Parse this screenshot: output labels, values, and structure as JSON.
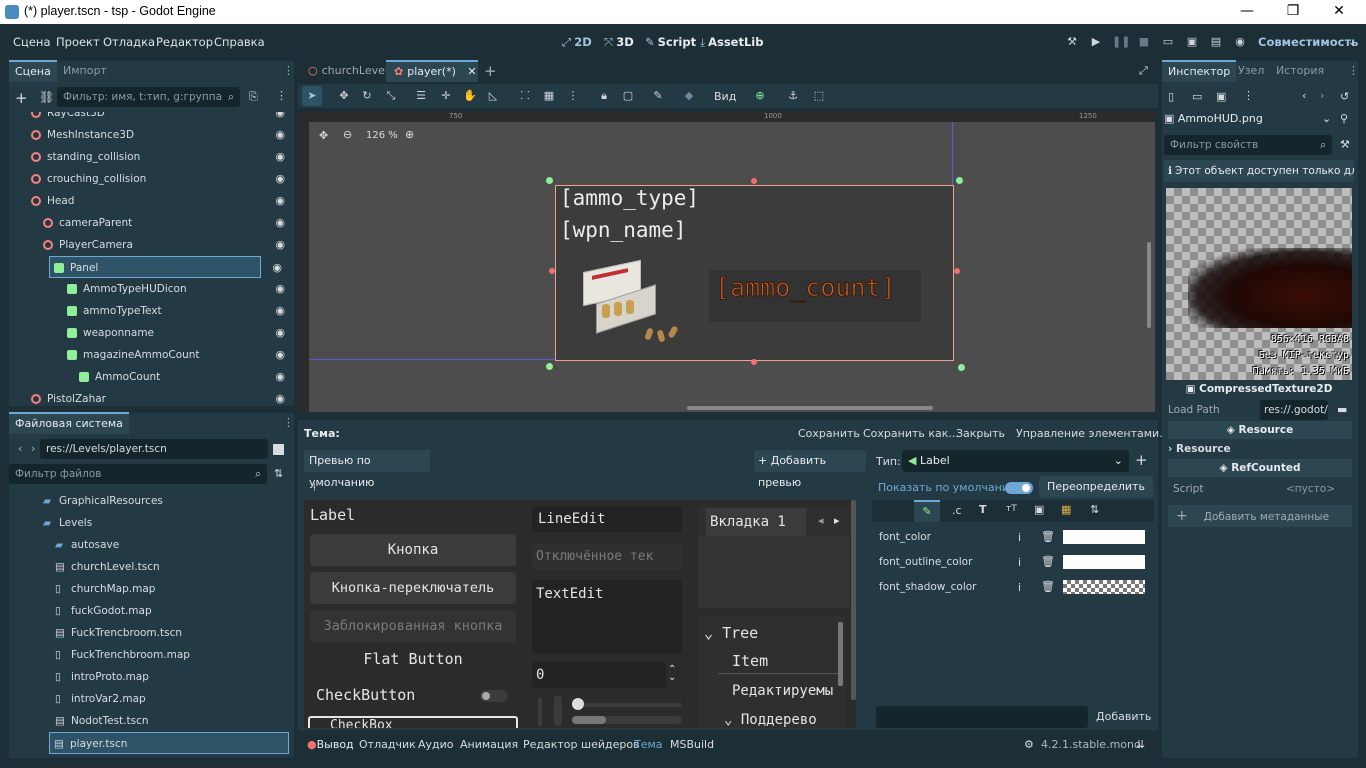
{
  "window": {
    "title": "(*) player.tscn - tsp - Godot Engine",
    "minimize": "—",
    "maximize": "❐",
    "close": "✕"
  },
  "menu": [
    "Сцена",
    "Проект",
    "Отладка",
    "Редактор",
    "Справка"
  ],
  "workspaces": [
    {
      "icon": "⤢",
      "label": "2D"
    },
    {
      "icon": "⤧",
      "label": "3D"
    },
    {
      "icon": "✎",
      "label": "Script"
    },
    {
      "icon": "⤓",
      "label": "AssetLib"
    }
  ],
  "renderer": "Совместимость",
  "scene_dock": {
    "tabs": [
      "Сцена",
      "Импорт"
    ],
    "filter_placeholder": "Фильтр: имя, t:тип, g:группа",
    "nodes": [
      {
        "name": "RayCast3D",
        "indent": 1,
        "color": "#fc7f7f"
      },
      {
        "name": "MeshInstance3D",
        "indent": 1,
        "color": "#fc7f7f"
      },
      {
        "name": "standing_collision",
        "indent": 1,
        "color": "#fc7f7f"
      },
      {
        "name": "crouching_collision",
        "indent": 1,
        "color": "#fc7f7f"
      },
      {
        "name": "Head",
        "indent": 1,
        "color": "#fc7f7f"
      },
      {
        "name": "cameraParent",
        "indent": 2,
        "color": "#fc7f7f"
      },
      {
        "name": "PlayerCamera",
        "indent": 2,
        "color": "#fc7f7f"
      },
      {
        "name": "Panel",
        "indent": 3,
        "color": "#8eef97"
      },
      {
        "name": "AmmoTypeHUDicon",
        "indent": 4,
        "color": "#8eef97"
      },
      {
        "name": "ammoTypeText",
        "indent": 4,
        "color": "#8eef97"
      },
      {
        "name": "weaponname",
        "indent": 4,
        "color": "#8eef97"
      },
      {
        "name": "magazineAmmoCount",
        "indent": 4,
        "color": "#8eef97"
      },
      {
        "name": "AmmoCount",
        "indent": 5,
        "color": "#8eef97"
      },
      {
        "name": "PistolZahar",
        "indent": 1,
        "color": "#fc7f7f"
      }
    ]
  },
  "fs_dock": {
    "title": "Файловая система",
    "path": "res://Levels/player.tscn",
    "filter_placeholder": "Фильтр файлов",
    "items": [
      {
        "name": "GraphicalResources",
        "type": "folder",
        "indent": 1
      },
      {
        "name": "Levels",
        "type": "folder",
        "indent": 1
      },
      {
        "name": "autosave",
        "type": "folder",
        "indent": 2
      },
      {
        "name": "churchLevel.tscn",
        "type": "scene",
        "indent": 2
      },
      {
        "name": "churchMap.map",
        "type": "file",
        "indent": 2
      },
      {
        "name": "fuckGodot.map",
        "type": "file",
        "indent": 2
      },
      {
        "name": "FuckTrencbroom.tscn",
        "type": "scene",
        "indent": 2
      },
      {
        "name": "FuckTrenchbroom.map",
        "type": "file",
        "indent": 2
      },
      {
        "name": "introProto.map",
        "type": "file",
        "indent": 2
      },
      {
        "name": "introVar2.map",
        "type": "file",
        "indent": 2
      },
      {
        "name": "NodotTest.tscn",
        "type": "scene",
        "indent": 2
      },
      {
        "name": "player.tscn",
        "type": "scene",
        "indent": 2
      }
    ]
  },
  "editor_tabs": [
    "churchLevel",
    "player(*)"
  ],
  "toolbar": {
    "view": "Вид"
  },
  "ruler": [
    "750",
    "1000",
    "1250"
  ],
  "zoom": "126 %",
  "hud": {
    "ammo_type": "[ammo_type]",
    "wpn_name": "[wpn_name]",
    "ammo_count": "[ammo_count]"
  },
  "theme": {
    "label": "Тема:",
    "buttons": [
      "Сохранить",
      "Сохранить как...",
      "Закрыть",
      "Управление элементами..."
    ],
    "preview_tab": "Превью по умолчанию",
    "add_preview": "Добавить превью",
    "type_label": "Тип:",
    "type_value": "Label",
    "show_default": "Показать по умолчанию",
    "override_all": "Переопределить всё",
    "props": [
      "font_color",
      "font_outline_color",
      "font_shadow_color"
    ],
    "add": "Добавить",
    "preview": {
      "label": "Label",
      "button": "Кнопка",
      "toggle": "Кнопка-переключатель",
      "disabled": "Заблокированная кнопка",
      "flat": "Flat Button",
      "check": "CheckButton",
      "lineedit": "LineEdit",
      "disabled_text": "Отключённое тек",
      "textedit": "TextEdit",
      "spin": "0",
      "tab1": "Вкладка 1",
      "tree": "Tree",
      "item": "Item",
      "editable": "Редактируемы",
      "subtree": "Поддерево",
      "checkbox": "CheckBox"
    }
  },
  "inspector": {
    "tabs": [
      "Инспектор",
      "Узел",
      "История"
    ],
    "resource": "AmmoHUD.png",
    "filter_placeholder": "Фильтр свойств",
    "readonly": "Этот объект доступен только для",
    "tex_info": [
      "856×416 RGBA8",
      "Без MIP-текстур",
      "Память: 1.35 МиБ"
    ],
    "class": "CompressedTexture2D",
    "load_path_label": "Load Path",
    "load_path": "res://.godot/",
    "res1": "Resource",
    "res_section": "Resource",
    "refcounted": "RefCounted",
    "script_label": "Script",
    "script_value": "<пусто>",
    "add_meta": "Добавить метаданные"
  },
  "bottom": {
    "tabs": [
      "Вывод",
      "Отладчик",
      "Аудио",
      "Анимация",
      "Редактор шейдеров",
      "Тема",
      "MSBuild"
    ],
    "version": "4.2.1.stable.mono"
  },
  "colors": {
    "accent": "#6ea8d6",
    "bg": "#1c2e36",
    "panel": "#233a44",
    "ammo": "#c8642a"
  }
}
